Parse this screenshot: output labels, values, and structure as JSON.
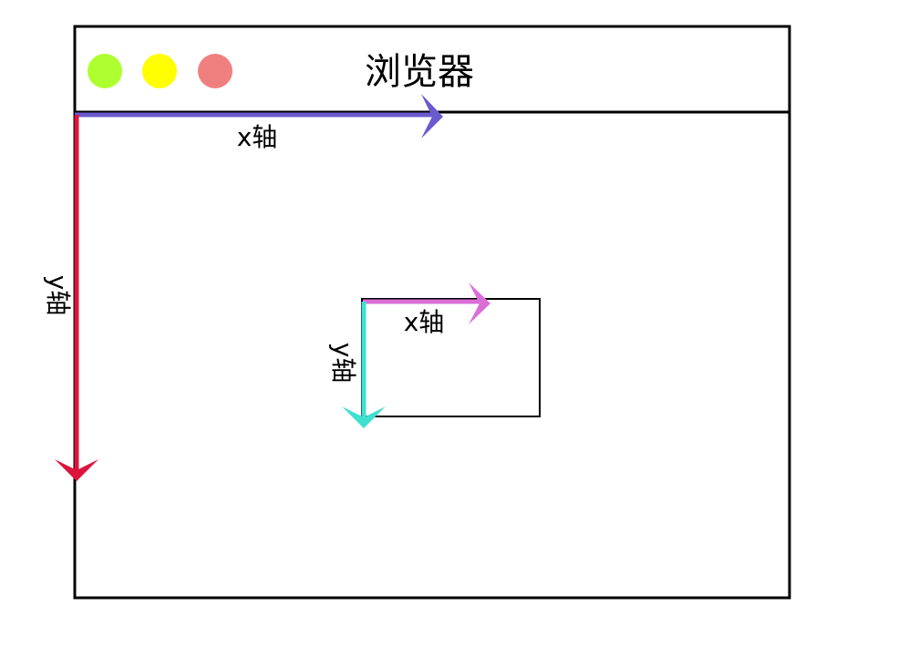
{
  "window": {
    "title": "浏览器",
    "buttons": [
      {
        "name": "green-dot",
        "color": "#adff2f"
      },
      {
        "name": "yellow-dot",
        "color": "#ffff00"
      },
      {
        "name": "red-dot",
        "color": "#f08080"
      }
    ]
  },
  "page_axes": {
    "x_label": "x轴",
    "y_label": "y轴",
    "x_color": "#6a5acd",
    "y_color": "#dc143c"
  },
  "element_axes": {
    "x_label": "x轴",
    "y_label": "y轴",
    "x_color": "#da70d6",
    "y_color": "#40e0d0"
  }
}
